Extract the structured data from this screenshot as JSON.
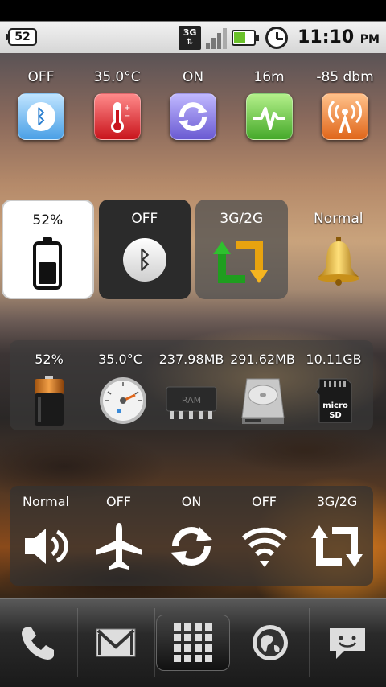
{
  "status_bar": {
    "notification_count": "52",
    "network": "3G",
    "time": "11:10",
    "ampm": "PM"
  },
  "row1": [
    {
      "label": "OFF",
      "icon": "bluetooth-icon"
    },
    {
      "label": "35.0°C",
      "icon": "thermometer-icon"
    },
    {
      "label": "ON",
      "icon": "sync-icon"
    },
    {
      "label": "16m",
      "icon": "activity-icon"
    },
    {
      "label": "-85 dbm",
      "icon": "signal-tower-icon"
    }
  ],
  "row2": [
    {
      "label": "52%",
      "icon": "battery-icon",
      "level": 0.52
    },
    {
      "label": "OFF",
      "icon": "bluetooth-icon"
    },
    {
      "label": "3G/2G",
      "icon": "network-switch-icon"
    },
    {
      "label": "Normal",
      "icon": "bell-icon"
    }
  ],
  "panel3": [
    {
      "label": "52%",
      "icon": "battery-cell-icon"
    },
    {
      "label": "35.0°C",
      "icon": "gauge-icon"
    },
    {
      "label": "237.98MB",
      "icon": "ram-chip-icon"
    },
    {
      "label": "291.62MB",
      "icon": "hard-drive-icon"
    },
    {
      "label": "10.11GB",
      "icon": "microsd-icon"
    }
  ],
  "panel4": [
    {
      "label": "Normal",
      "icon": "volume-icon"
    },
    {
      "label": "OFF",
      "icon": "airplane-icon"
    },
    {
      "label": "ON",
      "icon": "sync-icon"
    },
    {
      "label": "OFF",
      "icon": "wifi-icon"
    },
    {
      "label": "3G/2G",
      "icon": "network-switch-icon"
    }
  ],
  "ram_chip_text": "RAM",
  "dock": [
    {
      "icon": "phone-icon"
    },
    {
      "icon": "gmail-icon"
    },
    {
      "icon": "app-drawer-icon"
    },
    {
      "icon": "browser-globe-icon"
    },
    {
      "icon": "messaging-icon"
    }
  ]
}
